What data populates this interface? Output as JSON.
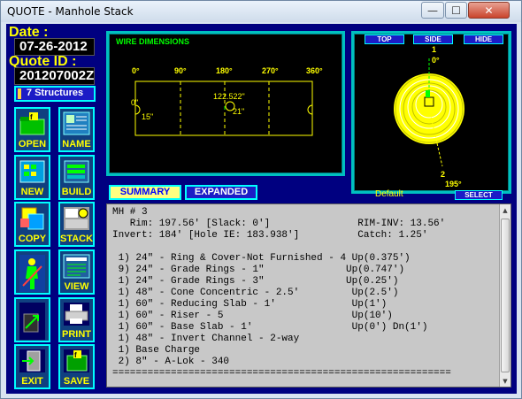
{
  "window": {
    "title": "QUOTE - Manhole Stack",
    "minimize": "—",
    "maximize": "☐",
    "close": "✕"
  },
  "left": {
    "date_label": "Date :",
    "date_value": "07-26-2012",
    "quote_label": "Quote ID :",
    "quote_value": "201207002Z",
    "structures": "7 Structures",
    "tools": [
      {
        "label": "OPEN",
        "icon": "open-folder-icon"
      },
      {
        "label": "NAME",
        "icon": "name-card-icon"
      },
      {
        "label": "NEW",
        "icon": "new-document-icon"
      },
      {
        "label": "BUILD",
        "icon": "build-icon"
      },
      {
        "label": "COPY",
        "icon": "copy-icon"
      },
      {
        "label": "STACK",
        "icon": "stack-icon"
      },
      {
        "label": "",
        "icon": "person-icon"
      },
      {
        "label": "VIEW",
        "icon": "view-icon"
      },
      {
        "label": "",
        "icon": "exit-arrow-icon"
      },
      {
        "label": "PRINT",
        "icon": "printer-icon"
      },
      {
        "label": "EXIT",
        "icon": "exit-door-icon"
      },
      {
        "label": "SAVE",
        "icon": "save-disk-icon"
      }
    ]
  },
  "wire": {
    "title": "WIRE DIMENSIONS",
    "degrees": [
      "0°",
      "90°",
      "180°",
      "270°",
      "360°"
    ],
    "labels": {
      "a": "0\"",
      "b": "15\"",
      "c": "122.522\"",
      "d": "21\""
    }
  },
  "top": {
    "buttons": [
      "TOP",
      "SIDE",
      "HIDE"
    ],
    "mark1": "1",
    "mark1_deg": "0°",
    "mark2": "2",
    "mark2_deg": "195°",
    "default": "Default",
    "select": "SELECT"
  },
  "tabs": {
    "summary": "SUMMARY",
    "expanded": "EXPANDED"
  },
  "summary_lines": [
    "MH # 3",
    "   Rim: 197.56' [Slack: 0']               RIM-INV: 13.56'",
    "Invert: 184' [Hole IE: 183.938']          Catch: 1.25'",
    "",
    " 1) 24\" - Ring & Cover-Not Furnished - 4 Up(0.375')",
    " 9) 24\" - Grade Rings - 1\"              Up(0.747')",
    " 1) 24\" - Grade Rings - 3\"              Up(0.25')",
    " 1) 48\" - Cone Concentric - 2.5'         Up(2.5')",
    " 1) 60\" - Reducing Slab - 1'             Up(1')",
    " 1) 60\" - Riser - 5                      Up(10')",
    " 1) 60\" - Base Slab - 1'                 Up(0') Dn(1')",
    " 1) 48\" - Invert Channel - 2-way",
    " 1) Base Charge",
    " 2) 8\" - A-Lok - 340",
    "=========================================================="
  ]
}
